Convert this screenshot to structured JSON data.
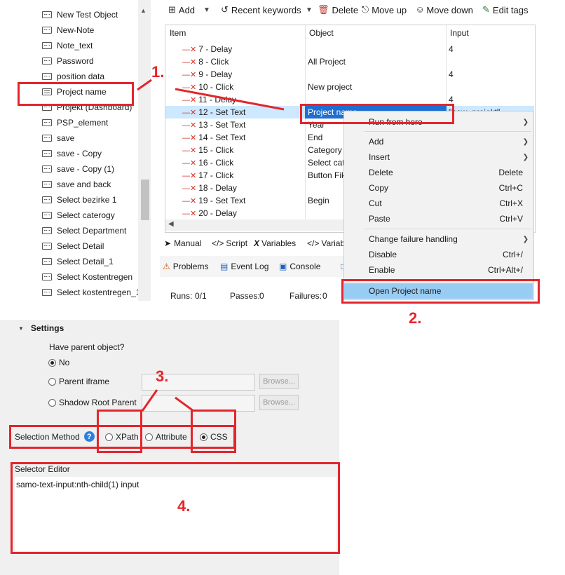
{
  "tree": {
    "items": [
      {
        "label": "New Test Object",
        "icon": "note-icon"
      },
      {
        "label": "New-Note",
        "icon": "note-icon"
      },
      {
        "label": "Note_text",
        "icon": "note-icon"
      },
      {
        "label": "Password",
        "icon": "note-icon"
      },
      {
        "label": "position data",
        "icon": "note-icon"
      },
      {
        "label": "Project name",
        "icon": "note-lines-icon"
      },
      {
        "label": "Projekt (Dashboard)",
        "icon": "note-icon"
      },
      {
        "label": "PSP_element",
        "icon": "note-icon"
      },
      {
        "label": "save",
        "icon": "note-icon"
      },
      {
        "label": "save - Copy",
        "icon": "note-icon"
      },
      {
        "label": "save - Copy (1)",
        "icon": "note-icon"
      },
      {
        "label": "save and back",
        "icon": "note-icon"
      },
      {
        "label": "Select bezirke 1",
        "icon": "note-icon"
      },
      {
        "label": "Select caterogy",
        "icon": "note-icon"
      },
      {
        "label": "Select Department",
        "icon": "note-icon"
      },
      {
        "label": "Select Detail",
        "icon": "note-icon"
      },
      {
        "label": "Select Detail_1",
        "icon": "note-icon"
      },
      {
        "label": "Select Kostentregen",
        "icon": "note-icon"
      },
      {
        "label": "Select kostentregen_1",
        "icon": "note-icon"
      }
    ]
  },
  "toolbar": {
    "add": "Add",
    "recent_keywords": "Recent keywords",
    "delete": "Delete",
    "move_up": "Move up",
    "move_down": "Move down",
    "edit_tags": "Edit tags"
  },
  "table": {
    "headers": {
      "item": "Item",
      "object": "Object",
      "input": "Input"
    },
    "rows": [
      {
        "step": "7 - Delay",
        "object": "",
        "input": "4"
      },
      {
        "step": "8 - Click",
        "object": "All Project",
        "input": ""
      },
      {
        "step": "9 - Delay",
        "object": "",
        "input": "4"
      },
      {
        "step": "10 - Click",
        "object": "New project",
        "input": ""
      },
      {
        "step": "11 - Delay",
        "object": "",
        "input": "4"
      },
      {
        "step": "12 - Set Text",
        "object": "Project name",
        "input": "\"new_projekt\""
      },
      {
        "step": "13 - Set Text",
        "object": "Year",
        "input": ""
      },
      {
        "step": "14 - Set Text",
        "object": "End",
        "input": ""
      },
      {
        "step": "15 - Click",
        "object": "Category",
        "input": ""
      },
      {
        "step": "16 - Click",
        "object": "Select cate",
        "input": ""
      },
      {
        "step": "17 - Click",
        "object": "Button Fik",
        "input": ""
      },
      {
        "step": "18 - Delay",
        "object": "",
        "input": ""
      },
      {
        "step": "19 - Set Text",
        "object": "Begin",
        "input": ""
      },
      {
        "step": "20 - Delay",
        "object": "",
        "input": ""
      }
    ]
  },
  "view_tabs": {
    "manual": "Manual",
    "script": "Script",
    "variables": "Variables",
    "variables2": "Variab"
  },
  "bottom_tabs": {
    "problems": "Problems",
    "event_log": "Event Log",
    "console": "Console"
  },
  "stats": {
    "runs_label": "Runs:",
    "runs_value": "0/1",
    "passes_label": "Passes:",
    "passes_value": "0",
    "failures_label": "Failures:",
    "failures_value": "0"
  },
  "context_menu": {
    "run_from_here": "Run from here",
    "add": "Add",
    "insert": "Insert",
    "delete": "Delete",
    "delete_acc": "Delete",
    "copy": "Copy",
    "copy_acc": "Ctrl+C",
    "cut": "Cut",
    "cut_acc": "Ctrl+X",
    "paste": "Paste",
    "paste_acc": "Ctrl+V",
    "change_failure": "Change failure handling",
    "disable": "Disable",
    "disable_acc": "Ctrl+/",
    "enable": "Enable",
    "enable_acc": "Ctrl+Alt+/",
    "open_object": "Open Project name"
  },
  "settings": {
    "title": "Settings",
    "parent_question": "Have parent object?",
    "no": "No",
    "parent_iframe": "Parent iframe",
    "shadow_root": "Shadow Root Parent",
    "browse": "Browse...",
    "selection_method": "Selection Method",
    "xpath": "XPath",
    "attribute": "Attribute",
    "css": "CSS",
    "selector_editor": "Selector Editor",
    "selector_value": "samo-text-input:nth-child(1) input"
  },
  "annotations": {
    "n1": "1.",
    "n2": "2.",
    "n3": "3.",
    "n4": "4.",
    "color": "#e3262c"
  }
}
